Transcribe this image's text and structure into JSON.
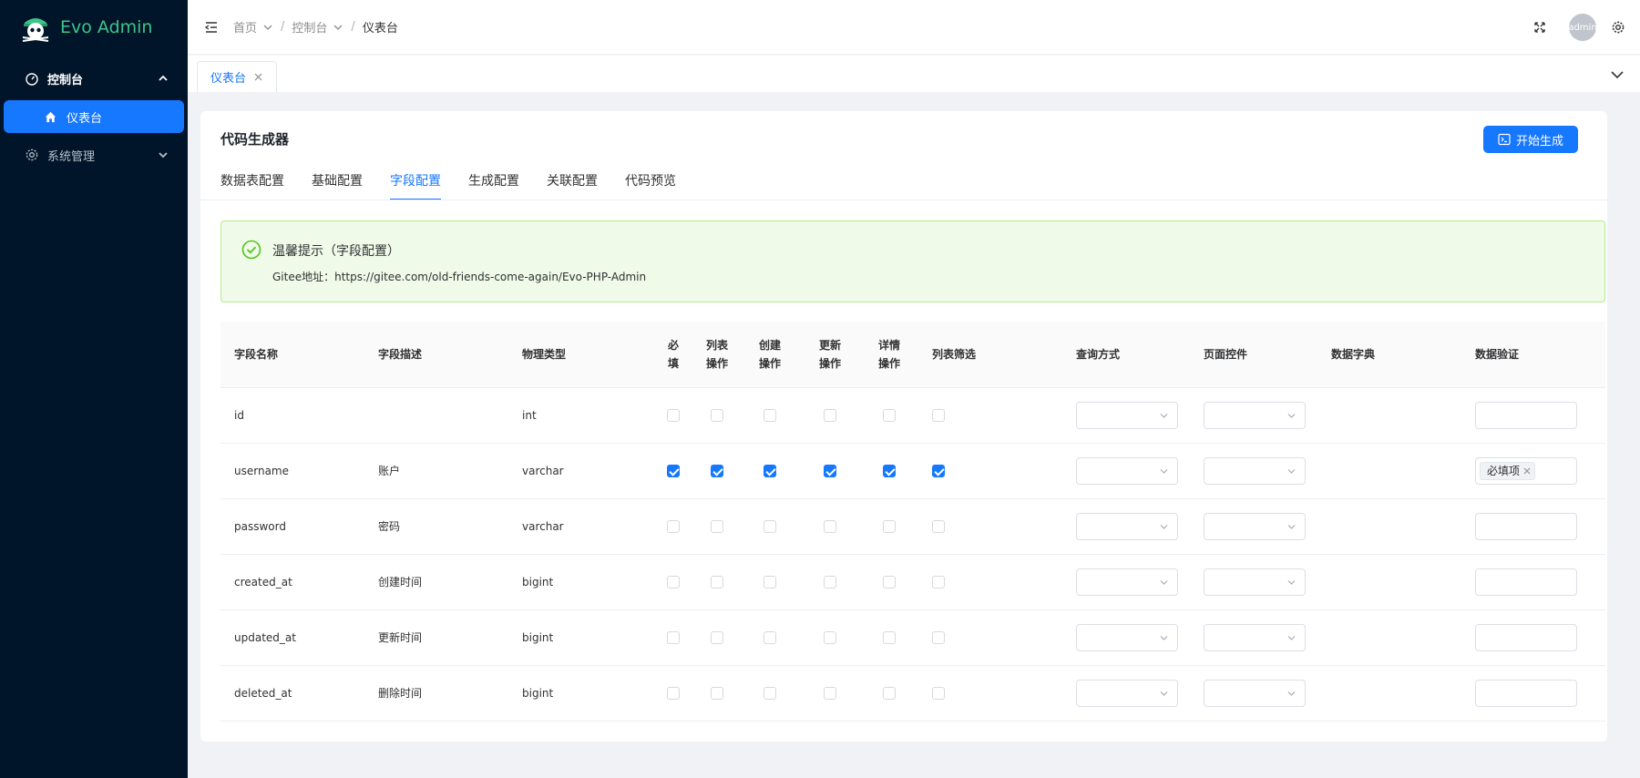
{
  "app": {
    "name": "Evo Admin"
  },
  "sidebar": {
    "groups": [
      {
        "label": "控制台",
        "icon": "dashboard-icon",
        "expanded": true,
        "children": [
          {
            "label": "仪表台",
            "icon": "home-icon",
            "active": true
          }
        ]
      },
      {
        "label": "系统管理",
        "icon": "gear-icon",
        "expanded": false
      }
    ]
  },
  "header": {
    "breadcrumb": [
      "首页",
      "控制台",
      "仪表台"
    ],
    "avatar_text": "admin"
  },
  "tabs": [
    {
      "label": "仪表台",
      "active": true
    }
  ],
  "card": {
    "title": "代码生成器",
    "action_label": "开始生成",
    "tabs": [
      "数据表配置",
      "基础配置",
      "字段配置",
      "生成配置",
      "关联配置",
      "代码预览"
    ],
    "active_tab": 2
  },
  "alert": {
    "title": "温馨提示（字段配置）",
    "desc": "Gitee地址：https://gitee.com/old-friends-come-again/Evo-PHP-Admin"
  },
  "table": {
    "headers": [
      "字段名称",
      "字段描述",
      "物理类型",
      [
        "必",
        "填"
      ],
      [
        "列表",
        "操作"
      ],
      [
        "创建",
        "操作"
      ],
      [
        "更新",
        "操作"
      ],
      [
        "详情",
        "操作"
      ],
      "列表筛选",
      "查询方式",
      "页面控件",
      "数据字典",
      "数据验证"
    ],
    "rows": [
      {
        "name": "id",
        "desc": "",
        "type": "int",
        "checks": [
          false,
          false,
          false,
          false,
          false,
          false
        ],
        "validation": []
      },
      {
        "name": "username",
        "desc": "账户",
        "type": "varchar",
        "checks": [
          true,
          true,
          true,
          true,
          true,
          true
        ],
        "validation": [
          "必填项"
        ]
      },
      {
        "name": "password",
        "desc": "密码",
        "type": "varchar",
        "checks": [
          false,
          false,
          false,
          false,
          false,
          false
        ],
        "validation": []
      },
      {
        "name": "created_at",
        "desc": "创建时间",
        "type": "bigint",
        "checks": [
          false,
          false,
          false,
          false,
          false,
          false
        ],
        "validation": []
      },
      {
        "name": "updated_at",
        "desc": "更新时间",
        "type": "bigint",
        "checks": [
          false,
          false,
          false,
          false,
          false,
          false
        ],
        "validation": []
      },
      {
        "name": "deleted_at",
        "desc": "删除时间",
        "type": "bigint",
        "checks": [
          false,
          false,
          false,
          false,
          false,
          false
        ],
        "validation": []
      }
    ]
  },
  "colors": {
    "primary": "#1677ff",
    "sidebar": "#001529",
    "logo": "#3ec48a",
    "success_bg": "#f0fae8",
    "success_border": "#b7eb8f"
  }
}
